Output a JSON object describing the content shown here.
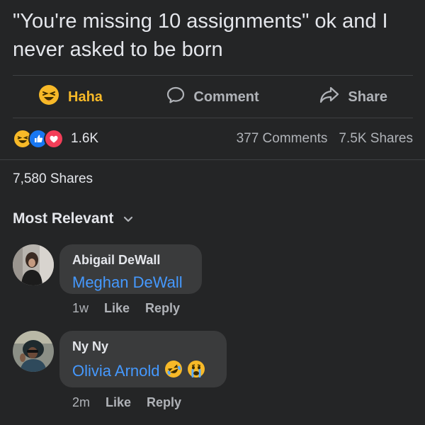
{
  "post": {
    "text": "\"You're missing 10 assignments\" ok and I never asked to be born"
  },
  "actions": {
    "haha": {
      "label": "Haha",
      "icon": "haha-emoji-icon"
    },
    "comment": {
      "label": "Comment",
      "icon": "comment-bubble-icon"
    },
    "share": {
      "label": "Share",
      "icon": "share-arrow-icon"
    }
  },
  "stats": {
    "reaction_count": "1.6K",
    "comments": "377 Comments",
    "shares": "7.5K Shares"
  },
  "shares_line": "7,580 Shares",
  "sort": {
    "label": "Most Relevant",
    "icon": "chevron-down-icon"
  },
  "comments": [
    {
      "author": "Abigail DeWall",
      "text": "Meghan DeWall",
      "time": "1w",
      "like": "Like",
      "reply": "Reply"
    },
    {
      "author": "Ny Ny",
      "text": "Olivia Arnold",
      "emojis": [
        "rolling-laughing-emoji-icon",
        "crying-emoji-icon"
      ],
      "time": "2m",
      "like": "Like",
      "reply": "Reply"
    }
  ],
  "colors": {
    "background": "#242526",
    "bubble": "#3a3b3c",
    "link_blue": "#4599ff",
    "haha_yellow": "#f7b928",
    "secondary_text": "#b0b3b8"
  }
}
